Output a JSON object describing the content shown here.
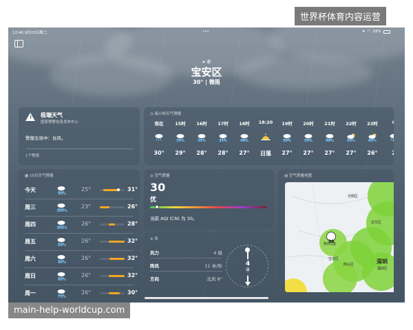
{
  "watermark_top": "世界杯体育内容运营",
  "watermark_bottom": "main-help-worldcup.com",
  "status_bar": {
    "time_date": "12:40 9月23日周二",
    "dots": "•••",
    "battery": "29%"
  },
  "header": {
    "location_icon_label": "➤ 家",
    "city": "宝安区",
    "temp_desc": "30° | 微雨"
  },
  "alert": {
    "title": "极端天气",
    "source": "国家预警信息发布中心",
    "message": "警报生效中：台风。",
    "more": "1个警报"
  },
  "hourly": {
    "title": "每小时天气预报",
    "items": [
      {
        "time": "现在",
        "pct": "",
        "temp": "30°",
        "icon": "cloud-rain-icon"
      },
      {
        "time": "15时",
        "pct": "35%",
        "temp": "29°",
        "icon": "cloud-rain-icon"
      },
      {
        "time": "16时",
        "pct": "35%",
        "temp": "28°",
        "icon": "cloud-rain-icon"
      },
      {
        "time": "17时",
        "pct": "35%",
        "temp": "28°",
        "icon": "cloud-rain-icon"
      },
      {
        "time": "18时",
        "pct": "40%",
        "temp": "27°",
        "icon": "cloud-rain-icon"
      },
      {
        "time": "18:20",
        "pct": "",
        "temp": "日落",
        "icon": "sunset-icon"
      },
      {
        "time": "19时",
        "pct": "50%",
        "temp": "27°",
        "icon": "cloud-rain-icon"
      },
      {
        "time": "20时",
        "pct": "55%",
        "temp": "27°",
        "icon": "cloud-rain-icon"
      },
      {
        "time": "21时",
        "pct": "50%",
        "temp": "27°",
        "icon": "cloud-rain-icon"
      },
      {
        "time": "22时",
        "pct": "50%",
        "temp": "27°",
        "icon": "moon-cloud-rain-icon"
      },
      {
        "time": "23时",
        "pct": "60%",
        "temp": "26°",
        "icon": "moon-cloud-rain-icon"
      },
      {
        "time": "0",
        "pct": "6",
        "temp": "2",
        "icon": "cloud-rain-icon"
      }
    ]
  },
  "tenday": {
    "title": "10日天气预报",
    "days": [
      {
        "day": "今天",
        "pct": "90%",
        "low": "25°",
        "high": "31°",
        "bar_start": 0.15,
        "bar_end": 0.8,
        "dot": 0.75
      },
      {
        "day": "周三",
        "pct": "100%",
        "low": "23°",
        "high": "26°",
        "bar_start": 0.0,
        "bar_end": 0.4,
        "dot": -1
      },
      {
        "day": "周四",
        "pct": "100%",
        "low": "26°",
        "high": "28°",
        "bar_start": 0.35,
        "bar_end": 0.6,
        "dot": -1
      },
      {
        "day": "周五",
        "pct": "60%",
        "low": "26°",
        "high": "32°",
        "bar_start": 0.35,
        "bar_end": 1.0,
        "dot": -1
      },
      {
        "day": "周六",
        "pct": "40%",
        "low": "26°",
        "high": "32°",
        "bar_start": 0.4,
        "bar_end": 1.0,
        "dot": -1
      },
      {
        "day": "周日",
        "pct": "60%",
        "low": "26°",
        "high": "32°",
        "bar_start": 0.35,
        "bar_end": 1.0,
        "dot": -1
      },
      {
        "day": "周一",
        "pct": "75%",
        "low": "26°",
        "high": "30°",
        "bar_start": 0.35,
        "bar_end": 0.8,
        "dot": -1
      }
    ]
  },
  "aqi": {
    "title": "空气质量",
    "value": "30",
    "level": "优",
    "desc": "当前 AQI (CN) 为 30。",
    "marker": 0.06
  },
  "wind": {
    "title": "风",
    "rows": [
      {
        "label": "风力",
        "value": "4 级"
      },
      {
        "label": "阵风",
        "value": "11 米/秒"
      },
      {
        "label": "方向",
        "value": "北风 8°"
      }
    ],
    "dial_value": "4",
    "dial_unit": "级",
    "dial_n": "北"
  },
  "aqmap": {
    "title": "空气质量地图",
    "labels": {
      "guangming": "光明区",
      "longhua": "龙华区",
      "baoan": "宝安区",
      "nanshan": "南山区",
      "shenzhen": "深圳",
      "futian": "福田区",
      "me": "我的位置",
      "me_value": "30"
    }
  },
  "colors": {
    "tenday_bar": "#f5a623",
    "rain_pct": "#7cc8ff",
    "map_green": "#7fd23a"
  }
}
